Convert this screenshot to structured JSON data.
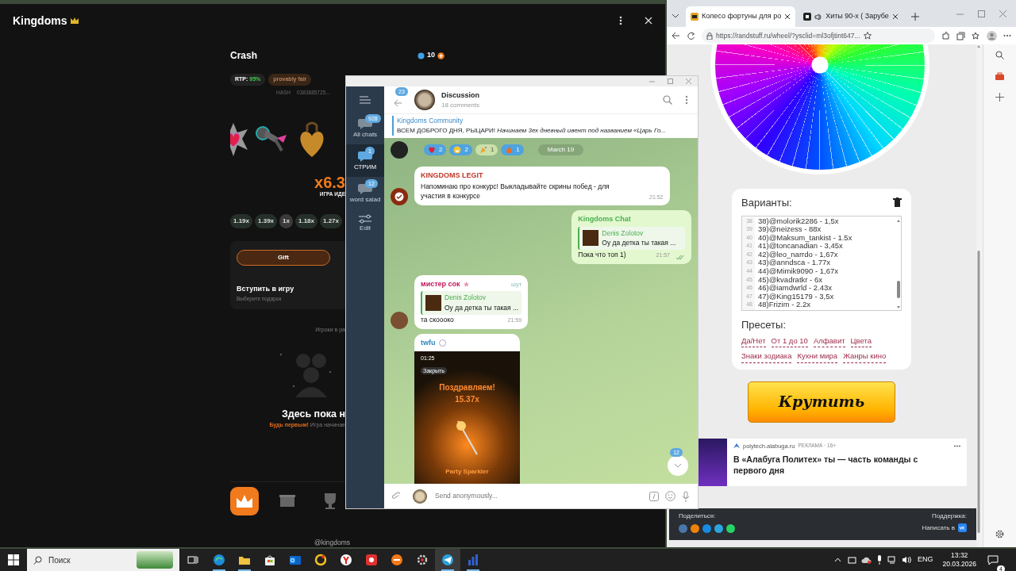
{
  "game_window": {
    "title": "Kingdoms",
    "game_title": "Crash",
    "balance": "10",
    "rtp_label": "RTP:",
    "rtp_value": "95%",
    "fair_badge": "provably fair",
    "hash_label": "HASH",
    "hash_value": "0383885725...",
    "multiplier": "x6.3",
    "status": "ИГРА ИДЕ",
    "history": [
      {
        "value": "1.19x",
        "color": "#26302a"
      },
      {
        "value": "1.39x",
        "color": "#26302a"
      },
      {
        "value": "1x",
        "color": "#3a3a3a"
      },
      {
        "value": "1.18x",
        "color": "#26302a"
      },
      {
        "value": "1.27x",
        "color": "#26302a"
      }
    ],
    "gift_button": "Gift",
    "join_title": "Вступить в игру",
    "join_subtitle": "Выберите подарок",
    "players_heading": "Игроки в ра",
    "empty_title": "Здесь пока н",
    "empty_cta": "Будь первым!",
    "empty_text": "Игра начинае",
    "nav": [
      {
        "kind": "crown",
        "selected": true
      },
      {
        "kind": "box",
        "selected": false
      },
      {
        "kind": "trophy",
        "selected": false
      }
    ],
    "footer": "@kingdoms"
  },
  "telegram": {
    "folders": [
      {
        "label": "All chats",
        "badge": "928",
        "selected": false
      },
      {
        "label": "СТРИМ",
        "badge": "1",
        "selected": true
      },
      {
        "label": "word salad",
        "badge": "12",
        "selected": false
      }
    ],
    "edit_label": "Edit",
    "back_badge": "23",
    "chat_title": "Discussion",
    "chat_subtitle": "18 comments",
    "pinned": {
      "title": "Kingdoms Community",
      "text": "ВСЕМ ДОБРОГО ДНЯ, РЫЦАРИ! *Начинаем 3ех дневный ивент под названием «Царь Го...*"
    },
    "reactions": [
      {
        "kind": "heart",
        "count": "2",
        "selected": true
      },
      {
        "kind": "grin",
        "count": "2",
        "selected": true
      },
      {
        "kind": "party",
        "count": "1",
        "selected": false
      },
      {
        "kind": "fire",
        "count": "1",
        "selected": true
      }
    ],
    "date": "March 19",
    "messages": [
      {
        "kind": "text",
        "outgoing": false,
        "sender": "KINGDOMS LEGIT",
        "color": "#c0392b",
        "text": "Напоминаю про конкурс! Выкладывайте скрины побед - для участия в конкурсе",
        "time": "21:52"
      },
      {
        "kind": "reply",
        "outgoing": true,
        "sender": "Kingdoms Chat",
        "color": "#4caf50",
        "reply_name": "Denis Zolotov",
        "reply_text": "Оу да детка ты такая ...",
        "text": "Пока что топ 1)",
        "time": "21:57",
        "read": true
      },
      {
        "kind": "reply",
        "outgoing": false,
        "sender": "мистер сок",
        "color": "#c2185b",
        "tag": "шут",
        "reply_name": "Denis Zolotov",
        "reply_text": "Оу да детка ты такая ...",
        "text": "та скоооко",
        "time": "21:59"
      },
      {
        "kind": "image",
        "outgoing": false,
        "sender": "twfu",
        "color": "#2e86c1",
        "image": {
          "time": "01:25",
          "close": "Закрыть",
          "title": "Поздравляем!",
          "multiplier": "15.37x",
          "item": "Party Sparkler"
        }
      }
    ],
    "unread_badge": "12",
    "composer": {
      "placeholder": "Send anonymously..."
    }
  },
  "browser": {
    "tabs": [
      {
        "title": "Колесо фортуны для ро",
        "selected": true,
        "audio": false
      },
      {
        "title": "Хиты 90-х ( Зарубе",
        "selected": false,
        "audio": true
      }
    ],
    "url": "https://randstuff.ru/wheel/?ysclid=ml3ofjtint647...",
    "variants_title": "Варианты:",
    "variants": [
      {
        "n": "38",
        "text": "38)@molorik2286 - 1,5x"
      },
      {
        "n": "39",
        "text": "39)@neizess - 88x"
      },
      {
        "n": "40",
        "text": "40)@Maksum_tankist - 1.5x"
      },
      {
        "n": "41",
        "text": "41)@toncanadian - 3,45x"
      },
      {
        "n": "42",
        "text": "42)@leo_narrdo - 1,67x"
      },
      {
        "n": "43",
        "text": "43)@anndsca - 1.77x"
      },
      {
        "n": "44",
        "text": "44)@Mimik9090 - 1,67x"
      },
      {
        "n": "45",
        "text": "45)@kvadratkr - 6x"
      },
      {
        "n": "46",
        "text": "46)@iamdwrld - 2.43x"
      },
      {
        "n": "47",
        "text": "47)@King15179 - 3,5x"
      },
      {
        "n": "48",
        "text": "48)Frizim - 2.2x"
      }
    ],
    "presets_title": "Пресеты:",
    "presets": [
      "Да/Нет",
      "От 1 до 10",
      "Алфавит",
      "Цвета",
      "Знаки зодиака",
      "Кухни мира",
      "Жанры кино"
    ],
    "spin_button": "Крутить",
    "ad": {
      "domain": "polytech.alabuga.ru",
      "label": "РЕКЛАМА · 16+",
      "headline": "В «Алабуга Политех» ты — часть команды с первого дня"
    },
    "share_label": "Поделиться:",
    "share_icons": [
      {
        "color": "#4a76a8"
      },
      {
        "color": "#ee8208"
      },
      {
        "color": "#168de2"
      },
      {
        "color": "#2ca5e0"
      },
      {
        "color": "#25d366"
      }
    ],
    "support_label": "Поддержка:",
    "support_link": "Написать в"
  },
  "taskbar": {
    "search_placeholder": "Поиск",
    "apps": [
      {
        "kind": "edge",
        "running": true,
        "selected": false
      },
      {
        "kind": "folder",
        "running": true,
        "selected": false
      },
      {
        "kind": "store",
        "running": false,
        "selected": false
      },
      {
        "kind": "mail",
        "running": false,
        "selected": false
      },
      {
        "kind": "ring",
        "running": false,
        "selected": false
      },
      {
        "kind": "yandex",
        "running": false,
        "selected": false
      },
      {
        "kind": "red",
        "running": false,
        "selected": false
      },
      {
        "kind": "orange",
        "running": false,
        "selected": false
      },
      {
        "kind": "gear",
        "running": false,
        "selected": false
      },
      {
        "kind": "plane",
        "running": true,
        "selected": true
      },
      {
        "kind": "chart",
        "running": true,
        "selected": false
      }
    ],
    "lang": "ENG",
    "time": "13:32",
    "date": "20.03.2026",
    "notifications": "4"
  }
}
